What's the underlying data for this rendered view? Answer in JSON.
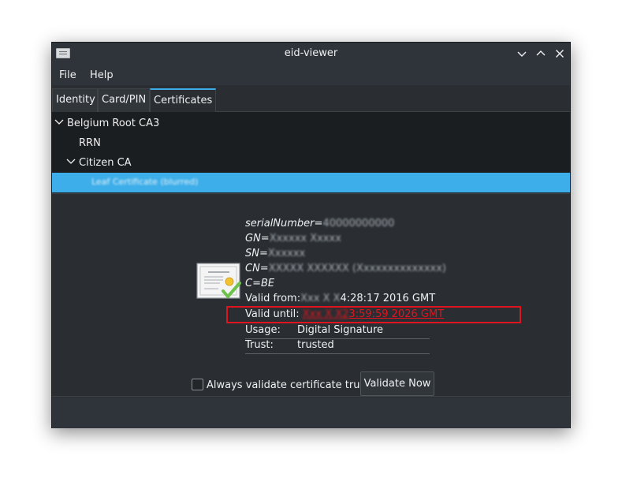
{
  "window": {
    "title": "eid-viewer"
  },
  "menu": {
    "file": "File",
    "help": "Help"
  },
  "tabs": [
    {
      "label": "Identity",
      "active": false
    },
    {
      "label": "Card/PIN",
      "active": false
    },
    {
      "label": "Certificates",
      "active": true
    }
  ],
  "tree": {
    "root": "Belgium Root CA3",
    "rrn": "RRN",
    "citizen_ca": "Citizen CA",
    "leaf_blurred": "Leaf Certificate (blurred)"
  },
  "cert": {
    "serial_label": "serialNumber=",
    "serial_value": "40000000000",
    "gn_label": "GN=",
    "gn_value": "Xxxxxx Xxxxx",
    "sn_label": "SN=",
    "sn_value": "Xxxxxx",
    "cn_label": "CN=",
    "cn_value": "XXXXX XXXXXX (Xxxxxxxxxxxxxx)",
    "c_label": "C=BE",
    "valid_from_label": "Valid from:",
    "valid_from_blurred": "Xxx X X",
    "valid_from_tail": "4:28:17 2016 GMT",
    "valid_until_label": "Valid until:",
    "valid_until_blurred": "Xxx X X2",
    "valid_until_tail": "3:59:59 2026 GMT",
    "usage_label": "Usage:",
    "usage_value": "Digital Signature",
    "trust_label": "Trust:",
    "trust_value": "trusted"
  },
  "controls": {
    "always_validate_label": "Always validate certificate trust",
    "validate_now_label": "Validate Now"
  },
  "colors": {
    "accent": "#3daee9",
    "warning_red": "#e0141e",
    "check_green": "#6cc24a"
  }
}
